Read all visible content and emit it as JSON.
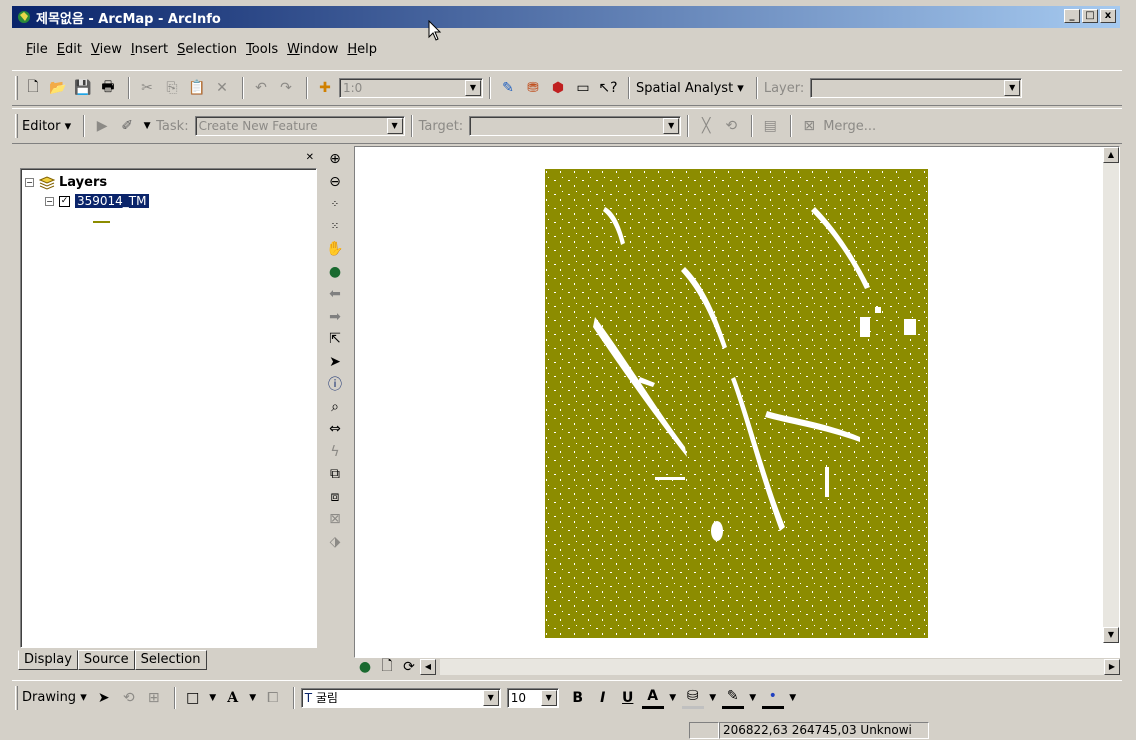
{
  "window": {
    "title": "제목없음 - ArcMap - ArcInfo",
    "min_label": "_",
    "max_label": "□",
    "close_label": "x"
  },
  "menu": [
    "File",
    "Edit",
    "View",
    "Insert",
    "Selection",
    "Tools",
    "Window",
    "Help"
  ],
  "standard_toolbar": {
    "scale_value": "1:0",
    "spatial_analyst_label": "Spatial Analyst ▾",
    "layer_label": "Layer:",
    "layer_value": ""
  },
  "editor_toolbar": {
    "editor_label": "Editor ▾",
    "task_label": "Task:",
    "task_value": "Create New Feature",
    "target_label": "Target:",
    "target_value": "",
    "merge_label": "Merge..."
  },
  "toc": {
    "root_label": "Layers",
    "layer_name": "359014_TM",
    "layer_checked": true,
    "tabs": [
      "Display",
      "Source",
      "Selection"
    ],
    "active_tab": "Display"
  },
  "vertical_tools": [
    "zoom-in-icon",
    "zoom-out-icon",
    "fixed-zoom-in-icon",
    "fixed-zoom-out-icon",
    "pan-icon",
    "full-extent-icon",
    "back-extent-icon",
    "forward-extent-icon",
    "select-features-icon",
    "select-elements-icon",
    "identify-icon",
    "find-icon",
    "measure-icon",
    "hyperlink-icon",
    "swipe-icon",
    "effects-icon",
    "flicker-icon",
    "clear-icon"
  ],
  "map": {
    "fill_color": "#8c8c00",
    "background": "#ffffff"
  },
  "drawing_toolbar": {
    "drawing_label": "Drawing ▾",
    "font_name": "굴림",
    "font_size": "10",
    "bold": "B",
    "italic": "I",
    "underline": "U",
    "font_color_label": "A",
    "text_label": "A"
  },
  "statusbar": {
    "coordinates": "206822,63  264745,03 Unknowi"
  }
}
